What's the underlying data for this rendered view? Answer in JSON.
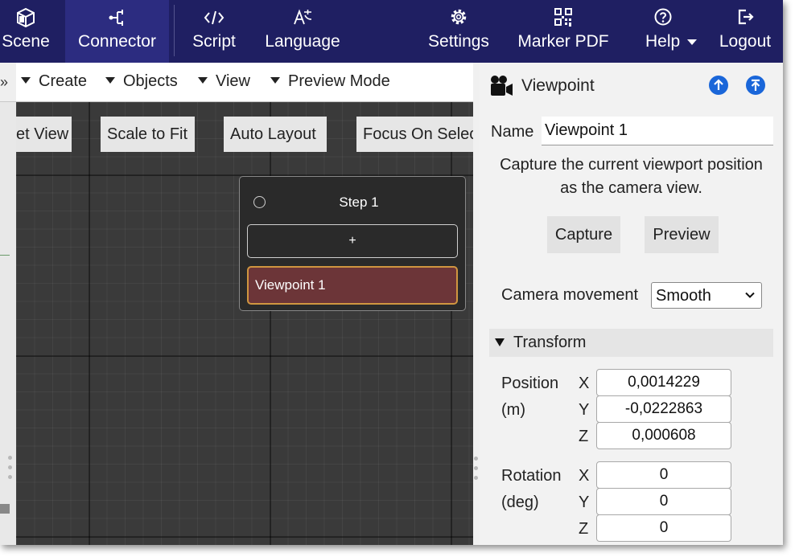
{
  "nav": {
    "items": [
      {
        "label": "Scene",
        "icon": "scene-icon"
      },
      {
        "label": "Connector",
        "icon": "connector-icon"
      },
      {
        "label": "Script",
        "icon": "code-icon"
      },
      {
        "label": "Language",
        "icon": "language-icon"
      },
      {
        "label": "Settings",
        "icon": "gear-icon"
      },
      {
        "label": "Marker PDF",
        "icon": "qr-icon"
      },
      {
        "label": "Help",
        "icon": "help-icon"
      },
      {
        "label": "Logout",
        "icon": "logout-icon"
      }
    ],
    "active": "Connector"
  },
  "toolbar": {
    "overflow": "»",
    "menus": [
      "Create",
      "Objects",
      "View",
      "Preview Mode"
    ]
  },
  "canvas": {
    "buttons": [
      "et View",
      "Scale to Fit",
      "Auto Layout",
      "Focus On Selec"
    ],
    "step": {
      "title": "Step 1",
      "add_label": "+",
      "viewpoint_label": "Viewpoint 1"
    }
  },
  "panel": {
    "title": "Viewpoint",
    "name_label": "Name",
    "name_value": "Viewpoint 1",
    "description_line1": "Capture the current viewport position",
    "description_line2": "as the camera view.",
    "capture_label": "Capture",
    "preview_label": "Preview",
    "camera_movement_label": "Camera movement",
    "camera_movement_value": "Smooth",
    "transform_label": "Transform",
    "position": {
      "label1": "Position",
      "label2": "(m)",
      "x": "0,0014229",
      "y": "-0,0222863",
      "z": "0,000608"
    },
    "rotation": {
      "label1": "Rotation",
      "label2": "(deg)",
      "x": "0",
      "y": "0",
      "z": "0"
    },
    "axes": [
      "X",
      "Y",
      "Z"
    ]
  },
  "colors": {
    "nav_bg": "#1f1f62",
    "nav_active": "#2c2c80",
    "accent_blue": "#1a66d9",
    "viewpoint_fill": "#6c3538",
    "viewpoint_border": "#d09640"
  }
}
